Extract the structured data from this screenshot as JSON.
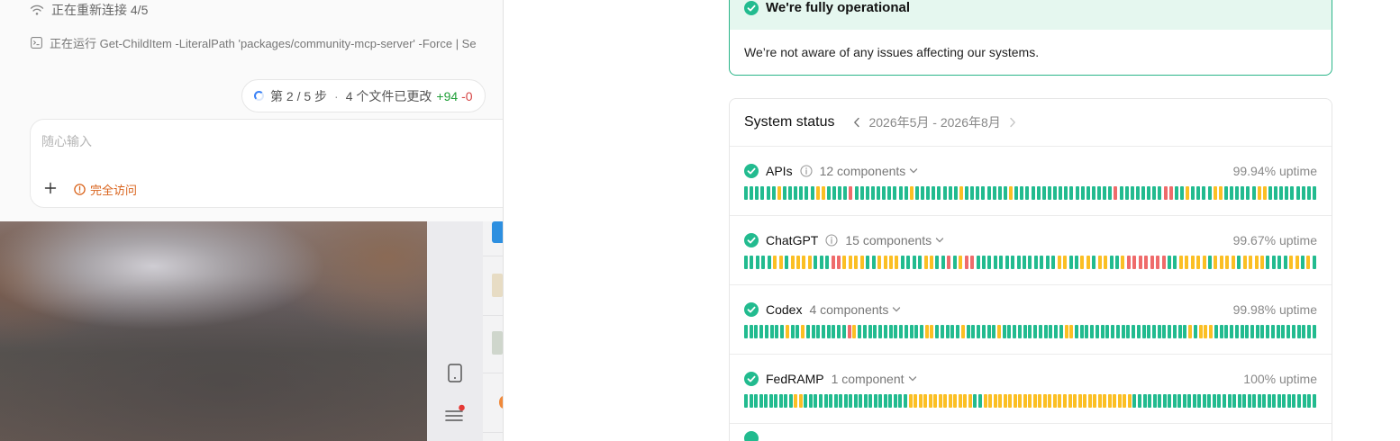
{
  "chat": {
    "reconnect_text": "正在重新连接 4/5",
    "running_text": "正在运行 Get-ChildItem -LiteralPath 'packages/community-mcp-server' -Force | Se",
    "progress": {
      "step_text": "第 2 / 5 步",
      "separator": "·",
      "files_text": "4 个文件已更改",
      "added": "+94",
      "removed": "-0"
    },
    "composer": {
      "placeholder": "随心输入",
      "plus_label": "+",
      "access_label": "完全访问"
    }
  },
  "sidebar": {
    "icons": [
      "phone-icon",
      "menu-icon"
    ],
    "notification_color": "#e53935"
  },
  "status_page": {
    "banner": {
      "title": "We're fully operational",
      "message": "We’re not aware of any issues affecting our systems."
    },
    "system_status": {
      "title": "System status",
      "date_range": "2026年5月 - 2026年8月",
      "legend_colors": {
        "g": "#22bb8f",
        "y": "#fbbf24",
        "r": "#ef6b6b"
      },
      "components": [
        {
          "name": "APIs",
          "has_info": true,
          "count_label": "12 components",
          "uptime": "99.94% uptime",
          "days": "ggggggyggggggyyggggrggggggggggyggggggggyggggggggyggggggggggggggggggrggggggggrrggyggggyyggggggyyggggggggg"
        },
        {
          "name": "ChatGPT",
          "has_info": true,
          "count_label": "15 components",
          "uptime": "99.67% uptime",
          "days": "gggggyygyyyygggrryyyyggyyyyggggyyggrgyrrggggggggggggggyyggyygyyggyrrrrrrrggyyyyygyyyygyyyyggggyygyg"
        },
        {
          "name": "Codex",
          "has_info": false,
          "count_label": "4 components",
          "uptime": "99.98% uptime",
          "days": "ggggggggyggyggggggggrygggggggggggggyygggggyggggggyggggggggggggyyggggggggggggggggggggggygyyygggggggggggggggggggg"
        },
        {
          "name": "FedRAMP",
          "has_info": false,
          "count_label": "1 component",
          "uptime": "100% uptime",
          "days": "ggggggggggyygggggggggggggggggggggyyyyyyyyyyyyyggyyyyyyyyyyyyyyyyyyyyyyyyyyyyyyggggggggggggggggggggggggggggggggggggg"
        }
      ]
    }
  }
}
